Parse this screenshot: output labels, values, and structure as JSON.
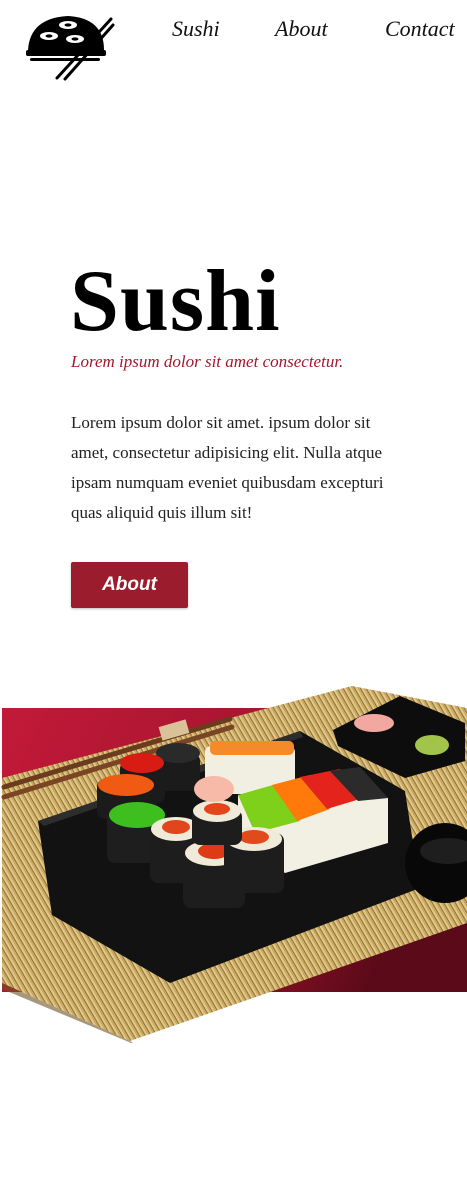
{
  "nav": {
    "items": [
      {
        "label": "Sushi"
      },
      {
        "label": "About"
      },
      {
        "label": "Contact"
      }
    ]
  },
  "hero": {
    "title": "Sushi",
    "subtitle": "Lorem ipsum dolor sit amet consectetur.",
    "body": "Lorem ipsum dolor sit amet. ipsum dolor sit amet, consectetur adipisicing elit. Nulla atque ipsam numquam eveniet quibusdam excepturi quas aliquid quis illum sit!",
    "button_label": "About"
  },
  "colors": {
    "accent": "#9b1c2c",
    "subtitle": "#a3172d",
    "banner_red": "#c21a38"
  },
  "icons": {
    "logo": "sushi-roll-logo-icon"
  }
}
